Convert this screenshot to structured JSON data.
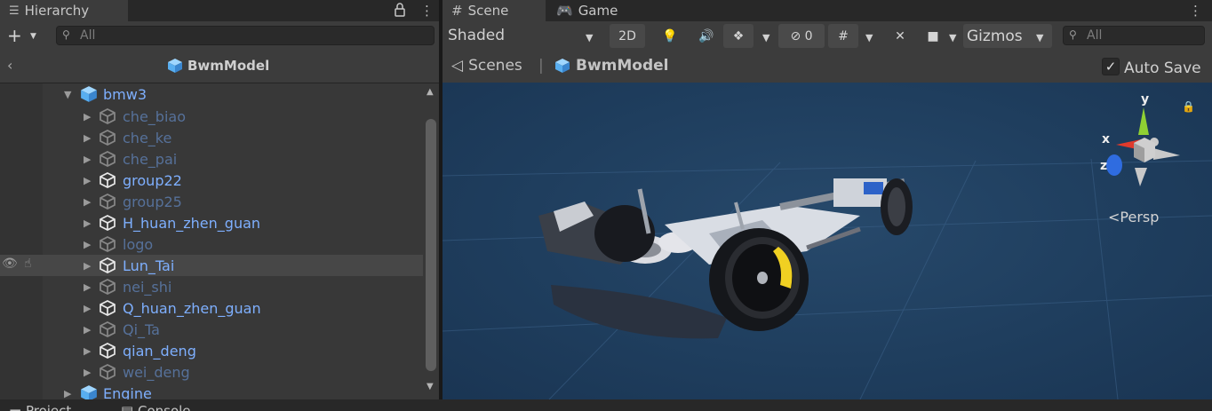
{
  "hierarchy": {
    "tab_label": "Hierarchy",
    "search_placeholder": "All",
    "breadcrumb_title": "BwmModel",
    "root": "bmw3",
    "items": [
      {
        "label": "che_biao",
        "state": "dim"
      },
      {
        "label": "che_ke",
        "state": "dim"
      },
      {
        "label": "che_pai",
        "state": "dim"
      },
      {
        "label": "group22",
        "state": "bright"
      },
      {
        "label": "group25",
        "state": "dim"
      },
      {
        "label": "H_huan_zhen_guan",
        "state": "bright"
      },
      {
        "label": "logo",
        "state": "dim"
      },
      {
        "label": "Lun_Tai",
        "state": "bright"
      },
      {
        "label": "nei_shi",
        "state": "dim"
      },
      {
        "label": "Q_huan_zhen_guan",
        "state": "bright"
      },
      {
        "label": "Qi_Ta",
        "state": "dim"
      },
      {
        "label": "qian_deng",
        "state": "bright"
      },
      {
        "label": "wei_deng",
        "state": "dim"
      }
    ],
    "next_root": "Engine"
  },
  "scene": {
    "tabs": [
      "Scene",
      "Game"
    ],
    "shading_mode": "Shaded",
    "btn_2d": "2D",
    "hidden_count": "0",
    "gizmos_label": "Gizmos",
    "search_placeholder": "All",
    "breadcrumb": [
      "Scenes",
      "BwmModel"
    ],
    "autosave_label": "Auto Save",
    "autosave_checked": true,
    "projection_label": "Persp",
    "axis_labels": {
      "x": "x",
      "y": "y",
      "z": "z"
    }
  },
  "bottom_tabs": [
    "Project",
    "Console"
  ],
  "colors": {
    "viewport_bg": "#1f3e5e",
    "active_item": "#7eaffe",
    "inactive_item": "#56719a",
    "axis_x": "#e03a2c",
    "axis_y": "#8fd033",
    "axis_z": "#2f6ce0"
  }
}
